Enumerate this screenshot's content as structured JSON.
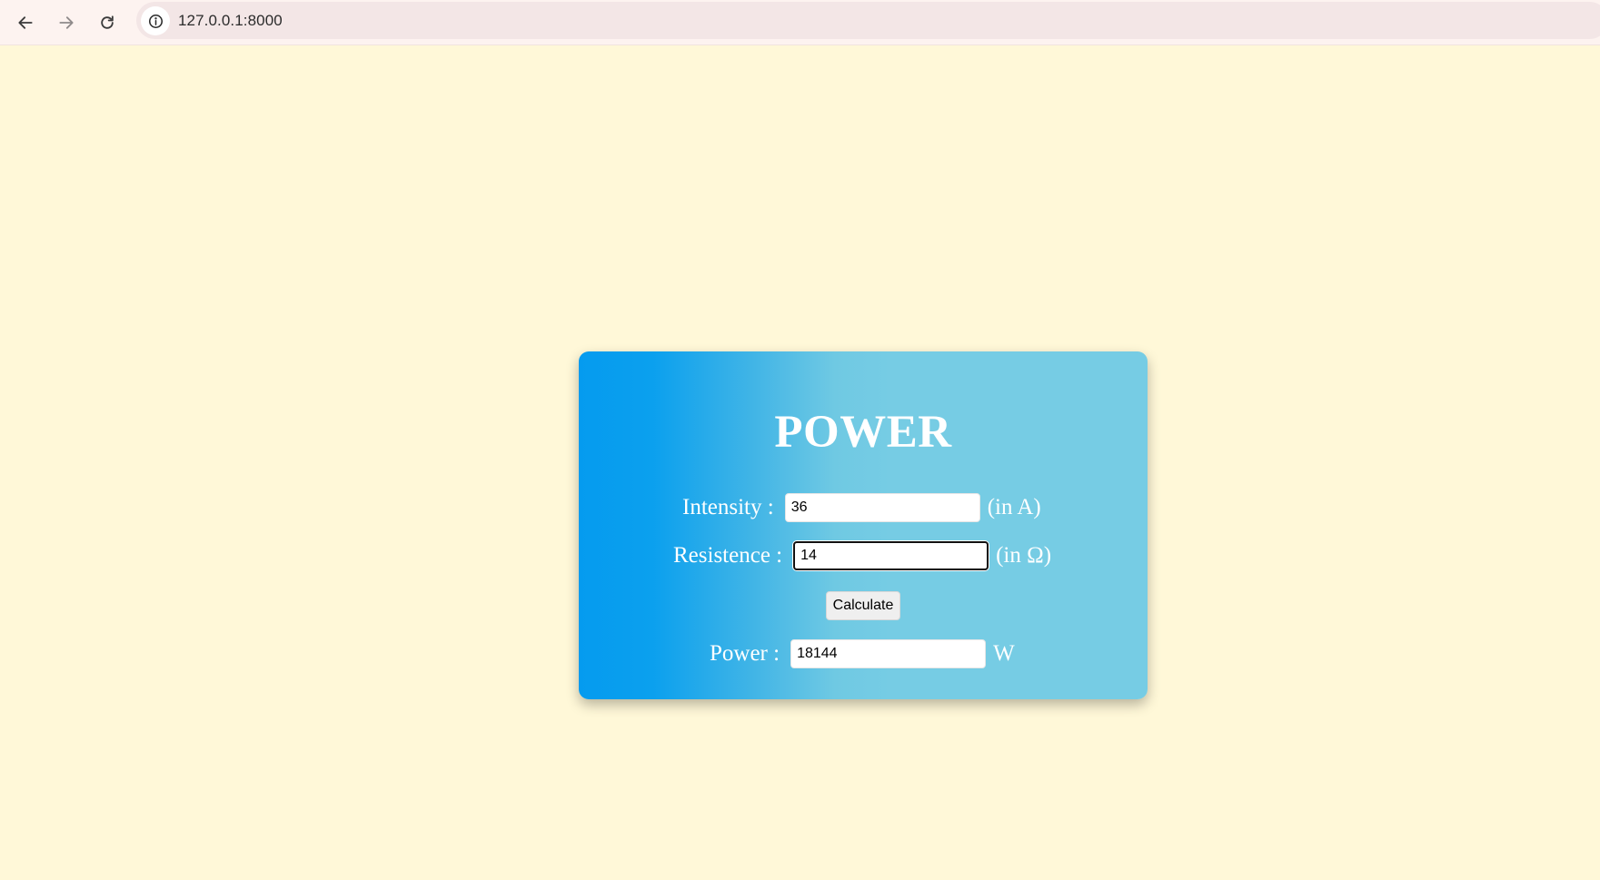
{
  "browser": {
    "url": "127.0.0.1:8000",
    "icons": {
      "back": "arrow-left-icon",
      "forward": "arrow-right-icon",
      "reload": "reload-icon",
      "site_info": "info-icon"
    }
  },
  "calculator": {
    "title": "POWER",
    "intensity": {
      "label": "Intensity :",
      "value": "36",
      "unit": "(in A)"
    },
    "resistence": {
      "label": "Resistence :",
      "value": "14",
      "unit": "(in Ω)"
    },
    "calculate_label": "Calculate",
    "power": {
      "label": "Power :",
      "value": "18144",
      "unit": "W"
    }
  },
  "colors": {
    "page_background": "#fff8d8",
    "card_gradient_start": "#059bef",
    "card_gradient_end": "#76cce4",
    "text": "#ffffff"
  }
}
